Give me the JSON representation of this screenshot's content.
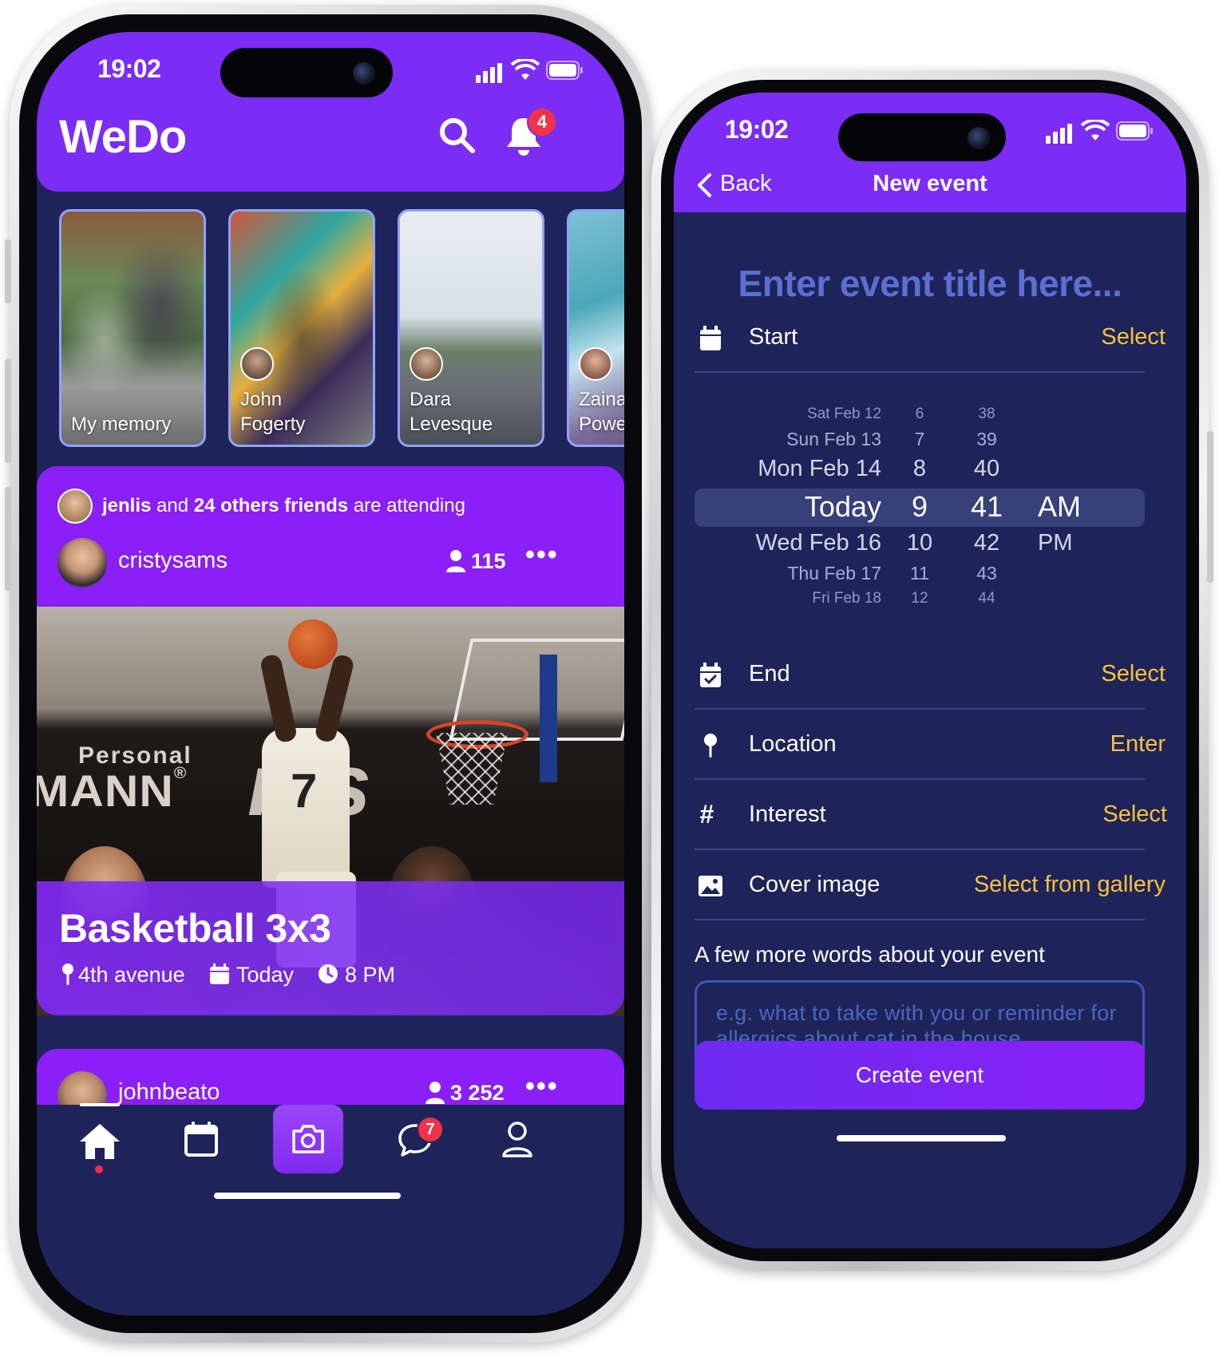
{
  "left_phone": {
    "status": {
      "time": "19:02"
    },
    "header": {
      "logo": "WeDo",
      "notification_count": "4"
    },
    "stories": [
      {
        "label": "My memory"
      },
      {
        "label": "John\nFogerty"
      },
      {
        "label": "Dara\nLevesque"
      },
      {
        "label": "Zaina\nPowell"
      }
    ],
    "event_card": {
      "friend_user": "jenlis",
      "friend_and": "and",
      "friend_others": "24 others friends",
      "friend_suffix": "are attending",
      "host": "cristysams",
      "attendees": "115",
      "title": "Basketball 3x3",
      "location": "4th avenue",
      "date": "Today",
      "time": "8 PM"
    },
    "next_card": {
      "host": "johnbeato",
      "attendees": "3 252"
    },
    "tabbar": {
      "items": [
        "home-icon",
        "calendar-icon",
        "camera-icon",
        "chat-icon",
        "profile-icon"
      ],
      "chat_badge": "7"
    }
  },
  "right_phone": {
    "status": {
      "time": "19:02"
    },
    "nav": {
      "back_label": "Back",
      "title": "New event"
    },
    "title_placeholder": "Enter event title here...",
    "start": {
      "label": "Start",
      "action": "Select"
    },
    "picker": {
      "dates": [
        "Sat Feb 12",
        "Sun Feb 13",
        "Mon Feb 14",
        "Today",
        "Wed Feb 16",
        "Thu Feb 17",
        "Fri Feb 18"
      ],
      "hours": [
        "6",
        "7",
        "8",
        "9",
        "10",
        "11",
        "12"
      ],
      "minutes": [
        "38",
        "39",
        "40",
        "41",
        "42",
        "43",
        "44"
      ],
      "ampm": [
        "AM",
        "PM"
      ],
      "selected": {
        "date": "Today",
        "hour": "9",
        "minute": "41",
        "period": "AM"
      }
    },
    "end": {
      "label": "End",
      "action": "Select"
    },
    "location": {
      "label": "Location",
      "action": "Enter"
    },
    "interest": {
      "label": "Interest",
      "action": "Select"
    },
    "cover": {
      "label": "Cover image",
      "action": "Select from gallery"
    },
    "description": {
      "label": "A few more words about your event",
      "placeholder": "e.g. what to take with you or reminder for allergics about cat in the house"
    },
    "create_button": "Create event"
  },
  "colors": {
    "brand_purple": "#7b2cf5",
    "navy": "#1e2459",
    "accent_yellow": "#f7c23b",
    "badge_red": "#f2314a"
  }
}
